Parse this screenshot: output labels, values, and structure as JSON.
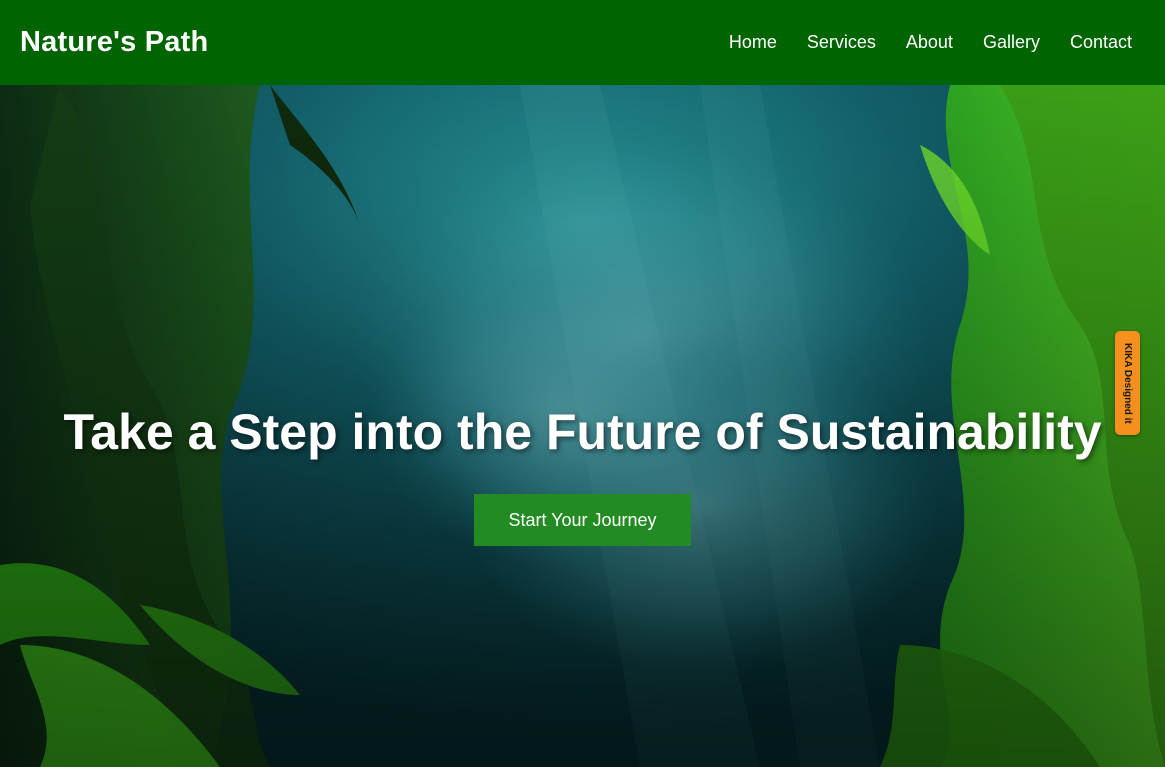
{
  "colors": {
    "nav_bg": "#006400",
    "cta_bg": "#228b22",
    "side_tab_bg": "#f5901e",
    "text": "#ffffff"
  },
  "header": {
    "logo": "Nature's Path",
    "nav": [
      {
        "label": "Home"
      },
      {
        "label": "Services"
      },
      {
        "label": "About"
      },
      {
        "label": "Gallery"
      },
      {
        "label": "Contact"
      }
    ]
  },
  "hero": {
    "background_image": "underwater-kelp-forest-with-sardine-school",
    "title": "Take a Step into the Future of Sustainability",
    "cta_label": "Start Your Journey"
  },
  "side_tab": {
    "label": "KIKA Designed it"
  }
}
